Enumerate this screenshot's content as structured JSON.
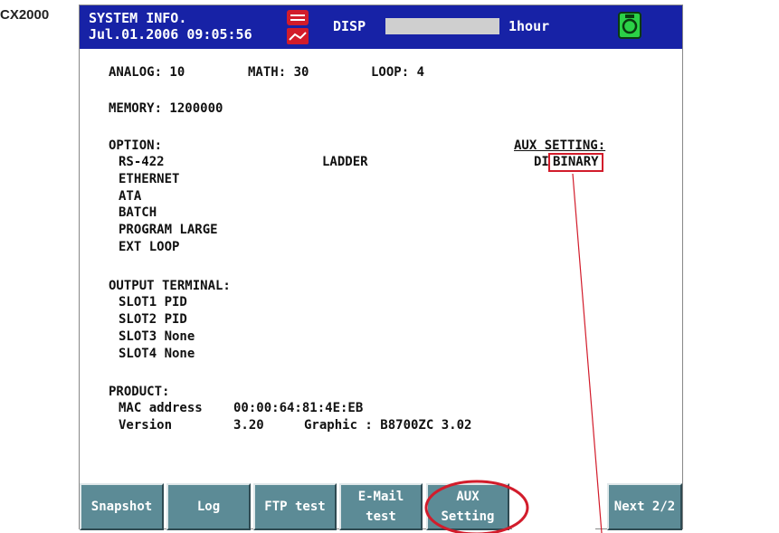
{
  "model": "CX2000",
  "header": {
    "title_line1": "SYSTEM INFO.",
    "title_line2": "Jul.01.2006 09:05:56",
    "disp_label": "DISP",
    "rate": "1hour",
    "colors": {
      "bar": "#1722a6",
      "record_icon": "#d21c2b",
      "media_icon": "#2bd147"
    }
  },
  "info": {
    "analog": "ANALOG: 10",
    "math": "MATH: 30",
    "loop": "LOOP: 4",
    "memory": "MEMORY: 1200000",
    "option_heading": "OPTION:",
    "options": [
      "RS-422",
      "ETHERNET",
      "ATA",
      "BATCH",
      "PROGRAM LARGE",
      "EXT LOOP"
    ],
    "option_right": "LADDER",
    "aux_heading": "AUX SETTING:",
    "aux_di_label": "DI",
    "aux_di_value": "BINARY",
    "output_heading": "OUTPUT TERMINAL:",
    "slots": [
      "SLOT1 PID",
      "SLOT2 PID",
      "SLOT3 None",
      "SLOT4 None"
    ],
    "product_heading": "PRODUCT:",
    "mac_label": "MAC address",
    "mac_value": "00:00:64:81:4E:EB",
    "version_label": "Version",
    "version_value": "3.20",
    "graphic": "Graphic : B8700ZC 3.02"
  },
  "softkeys": {
    "snapshot": "Snapshot",
    "log": "Log",
    "ftp_test": "FTP test",
    "email_line1": "E-Mail",
    "email_line2": "test",
    "aux_line1": "AUX",
    "aux_line2": "Setting",
    "next": "Next 2/2"
  },
  "annotation_color": "#d21c2b"
}
